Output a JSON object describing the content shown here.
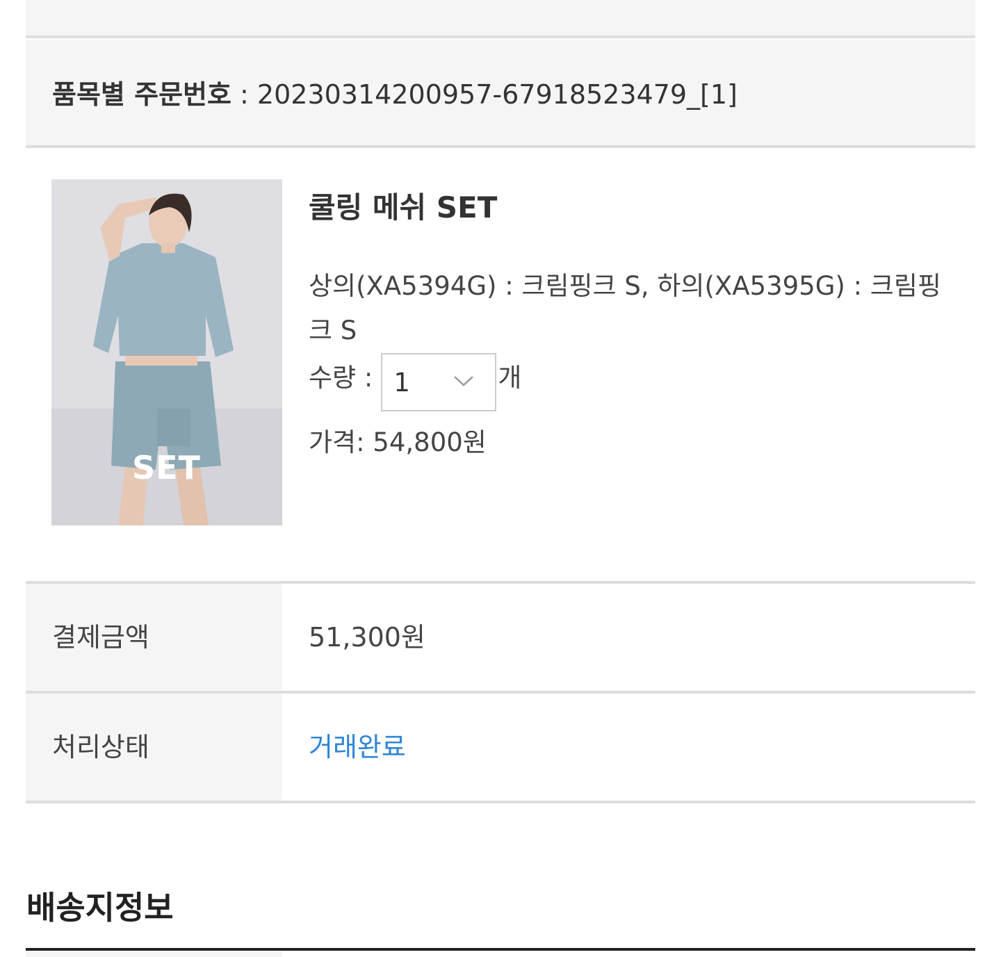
{
  "order": {
    "label": "품목별 주문번호",
    "separator": " : ",
    "number": "20230314200957-67918523479_[1]"
  },
  "product": {
    "thumb_badge": "SET",
    "name": "쿨링 메쉬 SET",
    "option": "상의(XA5394G) : 크림핑크 S, 하의(XA5395G) : 크림핑크 S",
    "qty_label": "수량 :",
    "qty_value": "1",
    "qty_unit": "개",
    "price_text": "가격: 54,800원"
  },
  "info": {
    "payment_label": "결제금액",
    "payment_value": "51,300원",
    "status_label": "처리상태",
    "status_value": "거래완료"
  },
  "shipping": {
    "title": "배송지정보"
  },
  "colors": {
    "status": "#2f86d4",
    "band": "#f5f5f5",
    "divider": "#dddddd"
  }
}
